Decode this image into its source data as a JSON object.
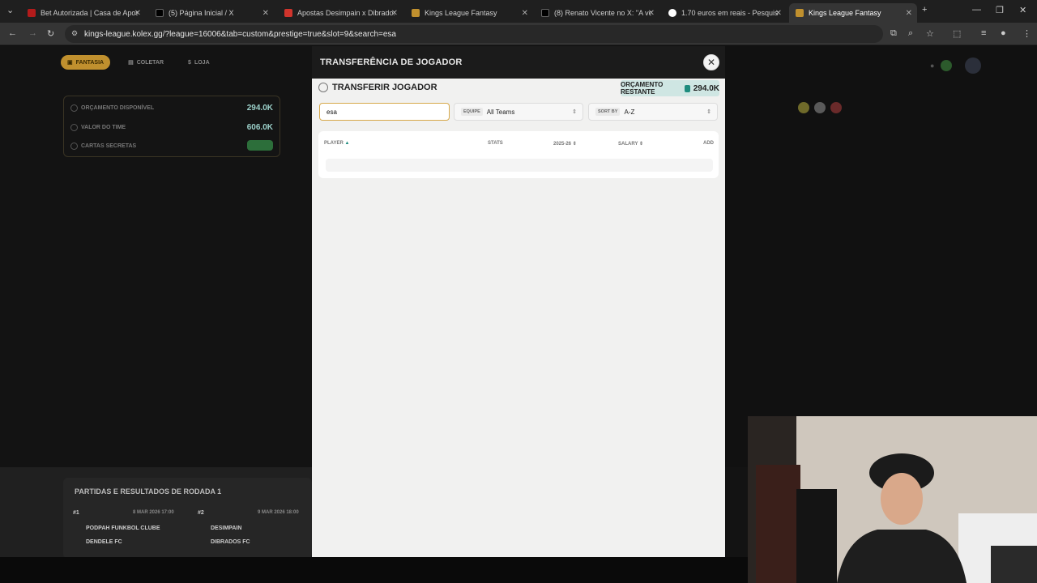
{
  "browser": {
    "tabs": [
      {
        "title": "Bet Autorizada | Casa de Apost",
        "color": "#b31b1b"
      },
      {
        "title": "(5) Página Inicial / X",
        "color": "#000000"
      },
      {
        "title": "Apostas Desimpain x Dibrados",
        "color": "#d0342c"
      },
      {
        "title": "Kings League Fantasy",
        "color": "#c0902e"
      },
      {
        "title": "(8) Renato Vicente no X: \"A voz",
        "color": "#000000"
      },
      {
        "title": "1.70 euros em reais - Pesquisa",
        "color": "#4285f4"
      },
      {
        "title": "Kings League Fantasy",
        "color": "#c0902e"
      }
    ],
    "url": "kings-league.kolex.gg/?league=16006&tab=custom&prestige=true&slot=9&search=esa"
  },
  "nav": {
    "fantasia": "FANTASIA",
    "coletar": "COLETAR",
    "loja": "LOJA"
  },
  "budget_card": {
    "orcamento_label": "ORÇAMENTO DISPONÍVEL",
    "orcamento_value": "294.0K",
    "valor_label": "VALOR DO TIME",
    "valor_value": "606.0K",
    "cartas_label": "CARTAS SECRETAS"
  },
  "matches": {
    "title": "PARTIDAS E RESULTADOS DE RODADA 1",
    "m1_num": "#1",
    "m1_date": "8 MAR 2026 17:00",
    "m1_team1": "PODPAH FUNKBOL CLUBE",
    "m1_team2": "DENDELE FC",
    "m2_num": "#2",
    "m2_date": "9 MAR 2026 18:00",
    "m2_team1": "DESIMPAIN",
    "m2_team2": "DIBRADOS FC"
  },
  "modal": {
    "header_title": "TRANSFERÊNCIA DE JOGADOR",
    "subtitle": "TRANSFERIR JOGADOR",
    "budget_label": "ORÇAMENTO RESTANTE",
    "budget_value": "294.0K",
    "search_value": "esa",
    "team_label": "EQUIPE",
    "team_value": "All Teams",
    "sort_label": "SORT BY",
    "sort_value": "A-Z",
    "columns": {
      "player": "PLAYER",
      "stats": "STATS",
      "season": "2025-26",
      "salary": "SALARY",
      "add": "ADD"
    }
  },
  "colors": {
    "accent_gold": "#c0902e",
    "budget_teal": "#1e8c7e"
  }
}
